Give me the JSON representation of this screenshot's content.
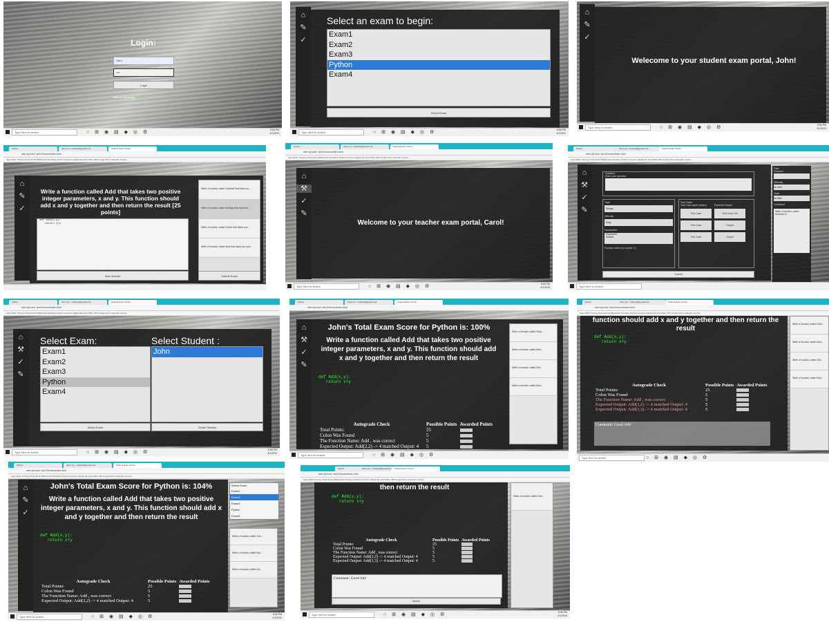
{
  "common": {
    "search_placeholder": "Type here to search",
    "tb_icons": "○ ⊞ ◉ ▤ ◆ ◎ ⚙",
    "clock_time": "8:56 PM",
    "clock_date": "4/1/2020",
    "tabs": [
      "Python",
      "Inbox (1) - redacted@gmail.com",
      "Student Exam Portal"
    ],
    "address": "web.njit.edu/~abc12/exam/index.html",
    "bookmarks": "Apps  Math Tutoring  Financial Aid  Blackboard  Workday  Student Services  Highlander Hub  Office 365  Google Drive  Calendar  Canvas"
  },
  "s1": {
    "title": "Login:",
    "user_value": "John",
    "pass_value": "••••",
    "login_btn": "Login",
    "noacct": "New an account?",
    "register": "Register"
  },
  "s2": {
    "title": "Select an exam to begin:",
    "exams": [
      "Exam1",
      "Exam2",
      "Exam3",
      "Python",
      "Exam4"
    ],
    "selected": "Python",
    "btn": "Select Exam"
  },
  "s3": {
    "welcome": "Welecome to your student exam portal, John!"
  },
  "s4": {
    "question": "Write a function called Add that takes two positive integer parameters, x and y. This function should add x and y together and then return the result [25 points]",
    "code_line1": "def Add(x,y):",
    "code_line2": "   return x+y",
    "cards": [
      "Write a function called Subtract that takes tw...",
      "Write a function called Multiply that takes tw...",
      "Write a function called Divide that takes two...",
      "Write a function called Mod that takes two pos..."
    ],
    "view_btn": "View Answer",
    "submit_btn": "Submit Exam"
  },
  "s5": {
    "welcome": "Welcome to your teacher exam portal, Carol!"
  },
  "s6": {
    "section1": "Question",
    "enter_question": "Enter your question:",
    "topic_label": "Topic",
    "topic_value": "Strings",
    "difficulty_label": "Difficulty",
    "difficulty_value": "Easy",
    "params_label": "Parameters",
    "param1": "Parameter",
    "param2": "Default",
    "fname_label": "Function name (no double-?):",
    "testcase_label": "Test Cases",
    "col1": "Test Case (input values)",
    "col2": "Expected Output",
    "tc1": "Test Case",
    "tc2": "Test Case Out",
    "tc3": "Test Case",
    "tc4": "Output",
    "tc5": "Test Case",
    "tc6": "Output",
    "filter_label": "Filter",
    "keyword": "Keyword",
    "difficulty_f": "Difficulty",
    "topic_f": "Topic",
    "none": "No filter",
    "constraint": "Constraint",
    "submit": "Submit",
    "preview": "Write a function called Subtract B..."
  },
  "s7": {
    "exam_title": "Select Exam:",
    "student_title": "Select Student :",
    "exams": [
      "Exam1",
      "Exam2",
      "Exam3",
      "Python",
      "Exam4"
    ],
    "students": [
      "John"
    ],
    "btn1": "Select Exam",
    "btn2": "Grade Student"
  },
  "s8": {
    "score": "John's Total Exam Score for Python is: 100%",
    "question": "Write a function called Add that takes two positive integer parameters, x and y. This function should add x and y together and then return the result",
    "code_line1": "def Add(x,y):",
    "code_line2": "   return x+y",
    "table_headers": [
      "Autograde Check",
      "Possible Points",
      "Awarded Points"
    ],
    "rows": [
      [
        "Total Points:",
        "25",
        ""
      ],
      [
        "Colon Was Found",
        "5",
        ""
      ],
      [
        "The Function Name: Add , was correct",
        "5",
        ""
      ],
      [
        "Expected Output: Add(2,2) -> 4 matched Output: 4",
        "5",
        ""
      ]
    ],
    "cards": [
      "Write a function called Subt...",
      "Write a function called Mult...",
      "Write a function called Divi...",
      "Write a function called Mod..."
    ]
  },
  "s9": {
    "question_tail": "function should add x and y together and then return the result",
    "code_line1": "def Add(x,y):",
    "code_line2": "   return x+y",
    "table_headers": [
      "Autograde Check",
      "Possible Points",
      "Awarded Points"
    ],
    "rows": [
      [
        "Total Points:",
        "25",
        ""
      ],
      [
        "Colon Was Found",
        "5",
        ""
      ],
      [
        "The Function Name: Add , was correct",
        "5",
        ""
      ],
      [
        "Expected Output: Add(2,2) -> 4 matched Output: 4",
        "5",
        ""
      ],
      [
        "Expected Output: Add(1,3) -> 4 matched Output: 4",
        "5",
        ""
      ]
    ],
    "comment": "Comment: Good Job!",
    "cards": [
      "Write a function called Subt...",
      "Write a function called Mult...",
      "Write a function called Divi...",
      "Write a function called Mod..."
    ]
  },
  "s10": {
    "score": "John's Total Exam Score for Python is: 104%",
    "question": "Write a function called Add that takes two positive integer parameters, x and y. This function should add x and y together and then return the result",
    "code_line1": "def Add(x,y):",
    "code_line2": "   return x+y",
    "select_label": "Select Exam",
    "options": [
      "Exam1",
      "Exam2",
      "Exam3",
      "Python",
      "Exam4"
    ],
    "table_headers": [
      "Autograde Check",
      "Possible Points",
      "Awarded Points"
    ],
    "rows": [
      [
        "Total Points:",
        "25",
        ""
      ],
      [
        "Colon Was Found",
        "5",
        ""
      ],
      [
        "The Function Name: Add , was correct",
        "5",
        ""
      ],
      [
        "Expected Output: Add(2,2) -> 4 matched Output: 4",
        "5",
        ""
      ]
    ],
    "cards": [
      "Write a function called Sub...",
      "Write a function called Mul...",
      "Write a function called Div..."
    ]
  },
  "s11": {
    "question_tail": "then return the result",
    "code_line1": "def Add(x,y):",
    "code_line2": "   return x+y",
    "table_headers": [
      "Autograde Check",
      "Possible Points",
      "Awarded Points"
    ],
    "rows": [
      [
        "Total Points:",
        "25",
        ""
      ],
      [
        "Colon Was Found",
        "5",
        ""
      ],
      [
        "The Function Name: Add , was correct",
        "5",
        ""
      ],
      [
        "Expected Output: Add(2,2) -> 4 matched Output: 4",
        "5",
        ""
      ],
      [
        "Expected Output: Add(1,3) -> 4 matched Output: 4",
        "5",
        ""
      ]
    ],
    "comment": "Comment: Good Job!",
    "submit": "Submit",
    "card": "Write a function called Sub..."
  }
}
